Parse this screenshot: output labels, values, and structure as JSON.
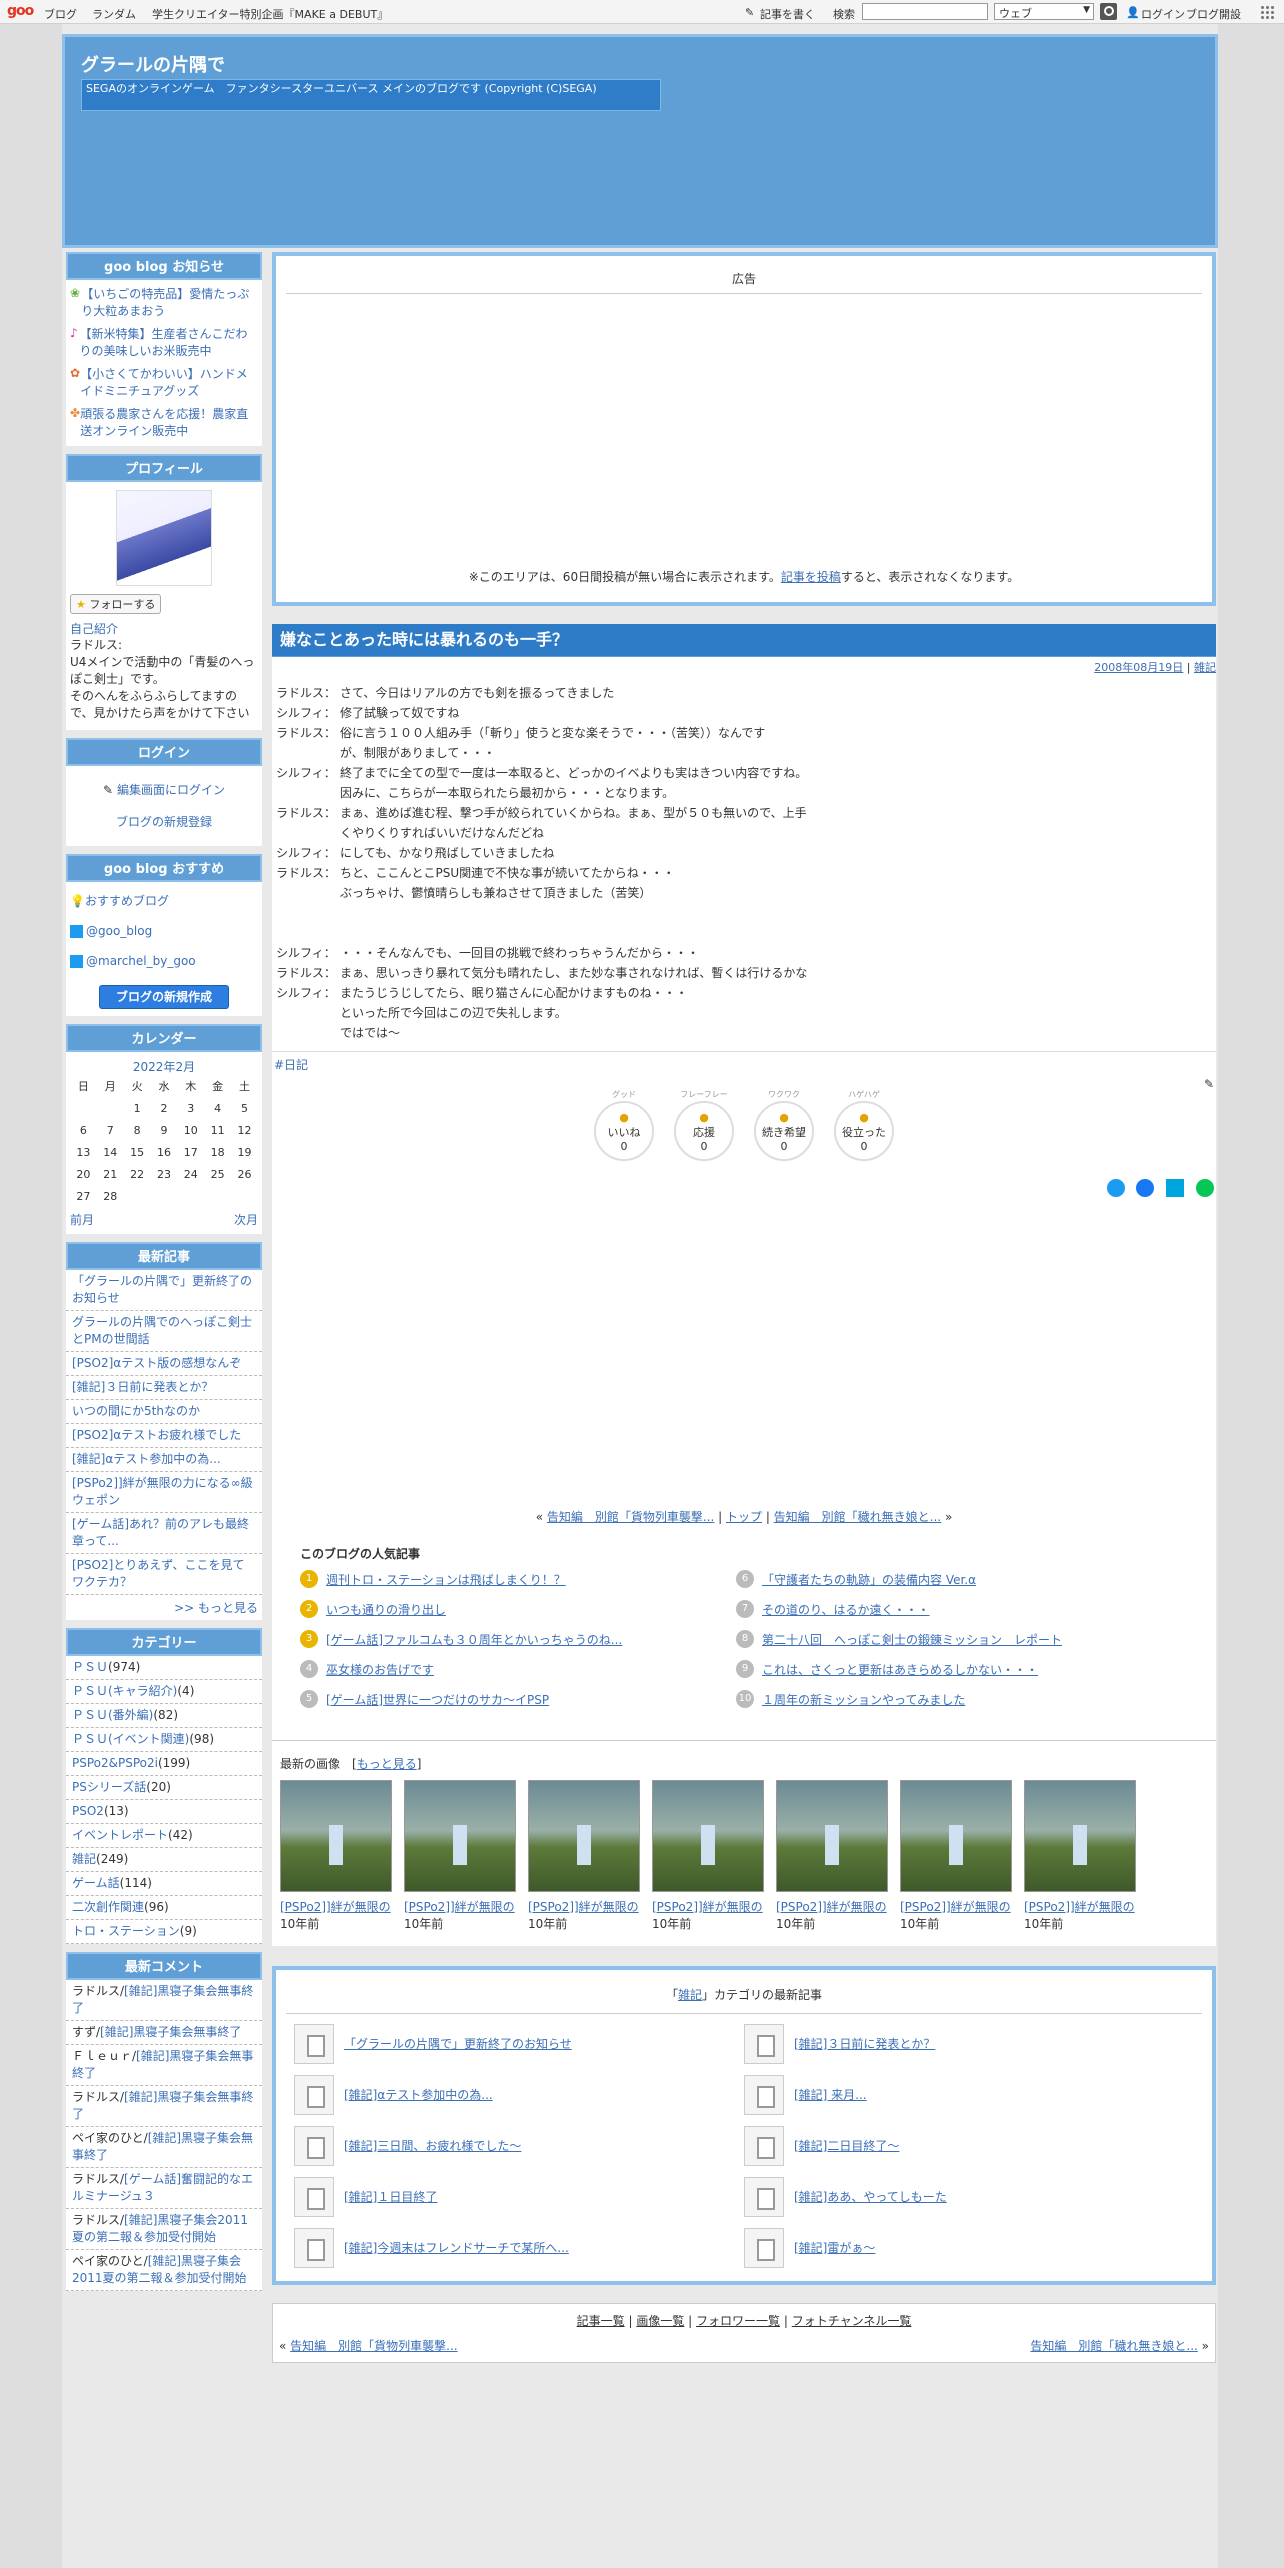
{
  "topbar": {
    "logo": "goo",
    "links": [
      "ブログ",
      "ランダム",
      "学生クリエイター特別企画『MAKE a DEBUT』"
    ],
    "write": "記事を書く",
    "search_label": "検索",
    "select_value": "ウェブ",
    "login": "ログイン",
    "open_blog": "ブログ開設"
  },
  "header": {
    "title": "グラールの片隅で",
    "desc": "SEGAのオンラインゲーム　ファンタシースターユニバース メインのブログです (Copyright (C)SEGA)"
  },
  "sidebar": {
    "notice_title": "goo blog お知らせ",
    "notices": [
      "【いちごの特売品】愛情たっぷり大粒あまおう",
      "【新米特集】生産者さんこだわりの美味しいお米販売中",
      "【小さくてかわいい】ハンドメイドミニチュアグッズ",
      "頑張る農家さんを応援！農家直送オンライン販売中"
    ],
    "profile_title": "プロフィール",
    "follow": "フォローする",
    "profile_link": "自己紹介",
    "profile_text": "ラドルス:\nU4メインで活動中の「青髪のへっぽこ剣士」です。\nそのへんをふらふらしてますので、見かけたら声をかけて下さい",
    "login_title": "ログイン",
    "login_edit": "編集画面にログイン",
    "login_new": "ブログの新規登録",
    "rec_title": "goo blog おすすめ",
    "rec_items": [
      "おすすめブログ",
      "@goo_blog",
      "@marchel_by_goo"
    ],
    "create_btn": "ブログの新規作成",
    "calendar_title": "カレンダー",
    "cal_month": "2022年2月",
    "cal_days": [
      "日",
      "月",
      "火",
      "水",
      "木",
      "金",
      "土"
    ],
    "cal_weeks": [
      [
        "",
        "",
        "1",
        "2",
        "3",
        "4",
        "5"
      ],
      [
        "6",
        "7",
        "8",
        "9",
        "10",
        "11",
        "12"
      ],
      [
        "13",
        "14",
        "15",
        "16",
        "17",
        "18",
        "19"
      ],
      [
        "20",
        "21",
        "22",
        "23",
        "24",
        "25",
        "26"
      ],
      [
        "27",
        "28",
        "",
        "",
        "",
        "",
        ""
      ]
    ],
    "cal_prev": "前月",
    "cal_next": "次月",
    "recent_title": "最新記事",
    "recent_items": [
      "「グラールの片隅で」更新終了のお知らせ",
      "グラールの片隅でのへっぽこ剣士とPMの世間話",
      "[PSO2]αテスト版の感想なんぞ",
      "[雑記]３日前に発表とか？",
      "いつの間にか5thなのか",
      "[PSO2]αテストお疲れ様でした",
      "[雑記]αテスト参加中の為...",
      "[PSPo2]]絆が無限の力になる∞級ウェポン",
      "[ゲーム話]あれ？前のアレも最終章って...",
      "[PSO2]とりあえず、ここを見てワクテカ？"
    ],
    "recent_more": ">> もっと見る",
    "category_title": "カテゴリー",
    "categories": [
      {
        "name": "ＰＳＵ",
        "count": "(974)"
      },
      {
        "name": "ＰＳＵ(キャラ紹介)",
        "count": "(4)"
      },
      {
        "name": "ＰＳＵ(番外編)",
        "count": "(82)"
      },
      {
        "name": "ＰＳＵ(イベント関連)",
        "count": "(98)"
      },
      {
        "name": "PSPo2&PSPo2i",
        "count": "(199)"
      },
      {
        "name": "PSシリーズ話",
        "count": "(20)"
      },
      {
        "name": "PSO2",
        "count": "(13)"
      },
      {
        "name": "イベントレポート",
        "count": "(42)"
      },
      {
        "name": "雑記",
        "count": "(249)"
      },
      {
        "name": "ゲーム話",
        "count": "(114)"
      },
      {
        "name": "二次創作関連",
        "count": "(96)"
      },
      {
        "name": "トロ・ステーション",
        "count": "(9)"
      }
    ],
    "comment_title": "最新コメント",
    "comments": [
      {
        "user": "ラドルス/",
        "link": "[雑記]黒寝子集会無事終了"
      },
      {
        "user": "すず/",
        "link": "[雑記]黒寝子集会無事終了"
      },
      {
        "user": "Ｆｌｅｕｒ/",
        "link": "[雑記]黒寝子集会無事終了"
      },
      {
        "user": "ラドルス/",
        "link": "[雑記]黒寝子集会無事終了"
      },
      {
        "user": "ペイ家のひと/",
        "link": "[雑記]黒寝子集会無事終了"
      },
      {
        "user": "ラドルス/",
        "link": "[ゲーム話]奮闘記的なエルミナージュ３"
      },
      {
        "user": "ラドルス/",
        "link": "[雑記]黒寝子集会2011夏の第二報＆参加受付開始"
      },
      {
        "user": "ペイ家のひと/",
        "link": "[雑記]黒寝子集会2011夏の第二報＆参加受付開始"
      }
    ]
  },
  "ad": {
    "label": "広告",
    "note_pre": "※このエリアは、60日間投稿が無い場合に表示されます。",
    "note_link": "記事を投稿",
    "note_post": "すると、表示されなくなります。"
  },
  "post": {
    "title": "嫌なことあった時には暴れるのも一手？",
    "date": "2008年08月19日",
    "category": "雑記",
    "lines": [
      [
        "ラドルス：",
        "さて、今日はリアルの方でも剣を振るってきました"
      ],
      [
        "シルフィ：",
        "修了試験って奴ですね"
      ],
      [
        "ラドルス：",
        "俗に言う１００人組み手（「斬り」使うと変な楽そうで・・・（苦笑））なんです"
      ],
      [
        "",
        "が、制限がありまして・・・"
      ],
      [
        "シルフィ：",
        "終了までに全ての型で一度は一本取ると、どっかのイベよりも実はきつい内容ですね。"
      ],
      [
        "",
        "因みに、こちらが一本取られたら最初から・・・となります。"
      ],
      [
        "ラドルス：",
        "まぁ、進めば進む程、撃つ手が絞られていくからね。まぁ、型が５０も無いので、上手"
      ],
      [
        "",
        "くやりくりすればいいだけなんだどね"
      ],
      [
        "シルフィ：",
        "にしても、かなり飛ばしていきましたね"
      ],
      [
        "ラドルス：",
        "ちと、ここんとこPSU関連で不快な事が続いてたからね・・・"
      ],
      [
        "",
        "ぶっちゃけ、鬱憤晴らしも兼ねさせて頂きました（苦笑）"
      ],
      [
        "",
        ""
      ],
      [
        "",
        ""
      ],
      [
        "シルフィ：",
        "・・・そんなんでも、一回目の挑戦で終わっちゃうんだから・・・"
      ],
      [
        "ラドルス：",
        "まぁ、思いっきり暴れて気分も晴れたし、また妙な事されなければ、暫くは行けるかな"
      ],
      [
        "シルフィ：",
        "またうじうじしてたら、眠り猫さんに心配かけますものね・・・"
      ],
      [
        "",
        "といった所で今回はこの辺で失礼します。"
      ],
      [
        "",
        "ではでは～"
      ]
    ],
    "tag": "#日記",
    "reactions": [
      {
        "top": "グッド",
        "label": "いいね",
        "count": "0"
      },
      {
        "top": "フレーフレー",
        "label": "応援",
        "count": "0"
      },
      {
        "top": "ワクワク",
        "label": "続き希望",
        "count": "0"
      },
      {
        "top": "ハゲハゲ",
        "label": "役立った",
        "count": "0"
      }
    ]
  },
  "nav": {
    "prev": "告知編　別館「貨物列車襲撃...",
    "top": "トップ",
    "next": "告知編　別館「穢れ無き娘と..."
  },
  "popular": {
    "title": "このブログの人気記事",
    "left": [
      "週刊トロ・ステーションは飛ばしまくり！？",
      "いつも通りの滑り出し",
      "[ゲーム話]ファルコムも３０周年とかいっちゃうのね...",
      "巫女様のお告げです",
      "[ゲーム話]世界に一つだけのサカ～イPSP"
    ],
    "right": [
      "「守護者たちの軌跡」の装備内容 Ver.α",
      "その道のり、はるか遠く・・・",
      "第二十八回　へっぽこ剣士の鍛錬ミッション　レポート",
      "これは、さくっと更新はあきらめるしかない・・・",
      "１周年の新ミッションやってみました"
    ],
    "nums_left": [
      "1",
      "2",
      "3",
      "4",
      "5"
    ],
    "nums_right": [
      "6",
      "7",
      "8",
      "9",
      "10"
    ]
  },
  "images": {
    "title": "最新の画像",
    "more": "もっと見る",
    "items": [
      {
        "cap": "[PSPo2]]絆が無限の",
        "age": "10年前"
      },
      {
        "cap": "[PSPo2]]絆が無限の",
        "age": "10年前"
      },
      {
        "cap": "[PSPo2]]絆が無限の",
        "age": "10年前"
      },
      {
        "cap": "[PSPo2]]絆が無限の",
        "age": "10年前"
      },
      {
        "cap": "[PSPo2]]絆が無限の",
        "age": "10年前"
      },
      {
        "cap": "[PSPo2]]絆が無限の",
        "age": "10年前"
      },
      {
        "cap": "[PSPo2]]絆が無限の",
        "age": "10年前"
      }
    ]
  },
  "catlatest": {
    "cat": "雑記",
    "suffix": "カテゴリの最新記事",
    "left": [
      "「グラールの片隅で」更新終了のお知らせ",
      "[雑記]αテスト参加中の為...",
      "[雑記]三日間、お疲れ様でした～",
      "[雑記]１日目終了",
      "[雑記]今週末はフレンドサーチで某所へ..."
    ],
    "right": [
      "[雑記]３日前に発表とか？",
      "[雑記] 来月...",
      "[雑記]二日目終了～",
      "[雑記]ああ、やってしもーた",
      "[雑記]雷がぁ～"
    ]
  },
  "footer": {
    "links": [
      "記事一覧",
      "画像一覧",
      "フォロワー一覧",
      "フォトチャンネル一覧"
    ],
    "prev": "告知編　別館「貨物列車襲撃...",
    "next": "告知編　別館「穢れ無き娘と..."
  },
  "colors": {
    "accent": "#5f9fd6",
    "title_bar": "#2e7bc8",
    "link": "#3b6fb6"
  }
}
